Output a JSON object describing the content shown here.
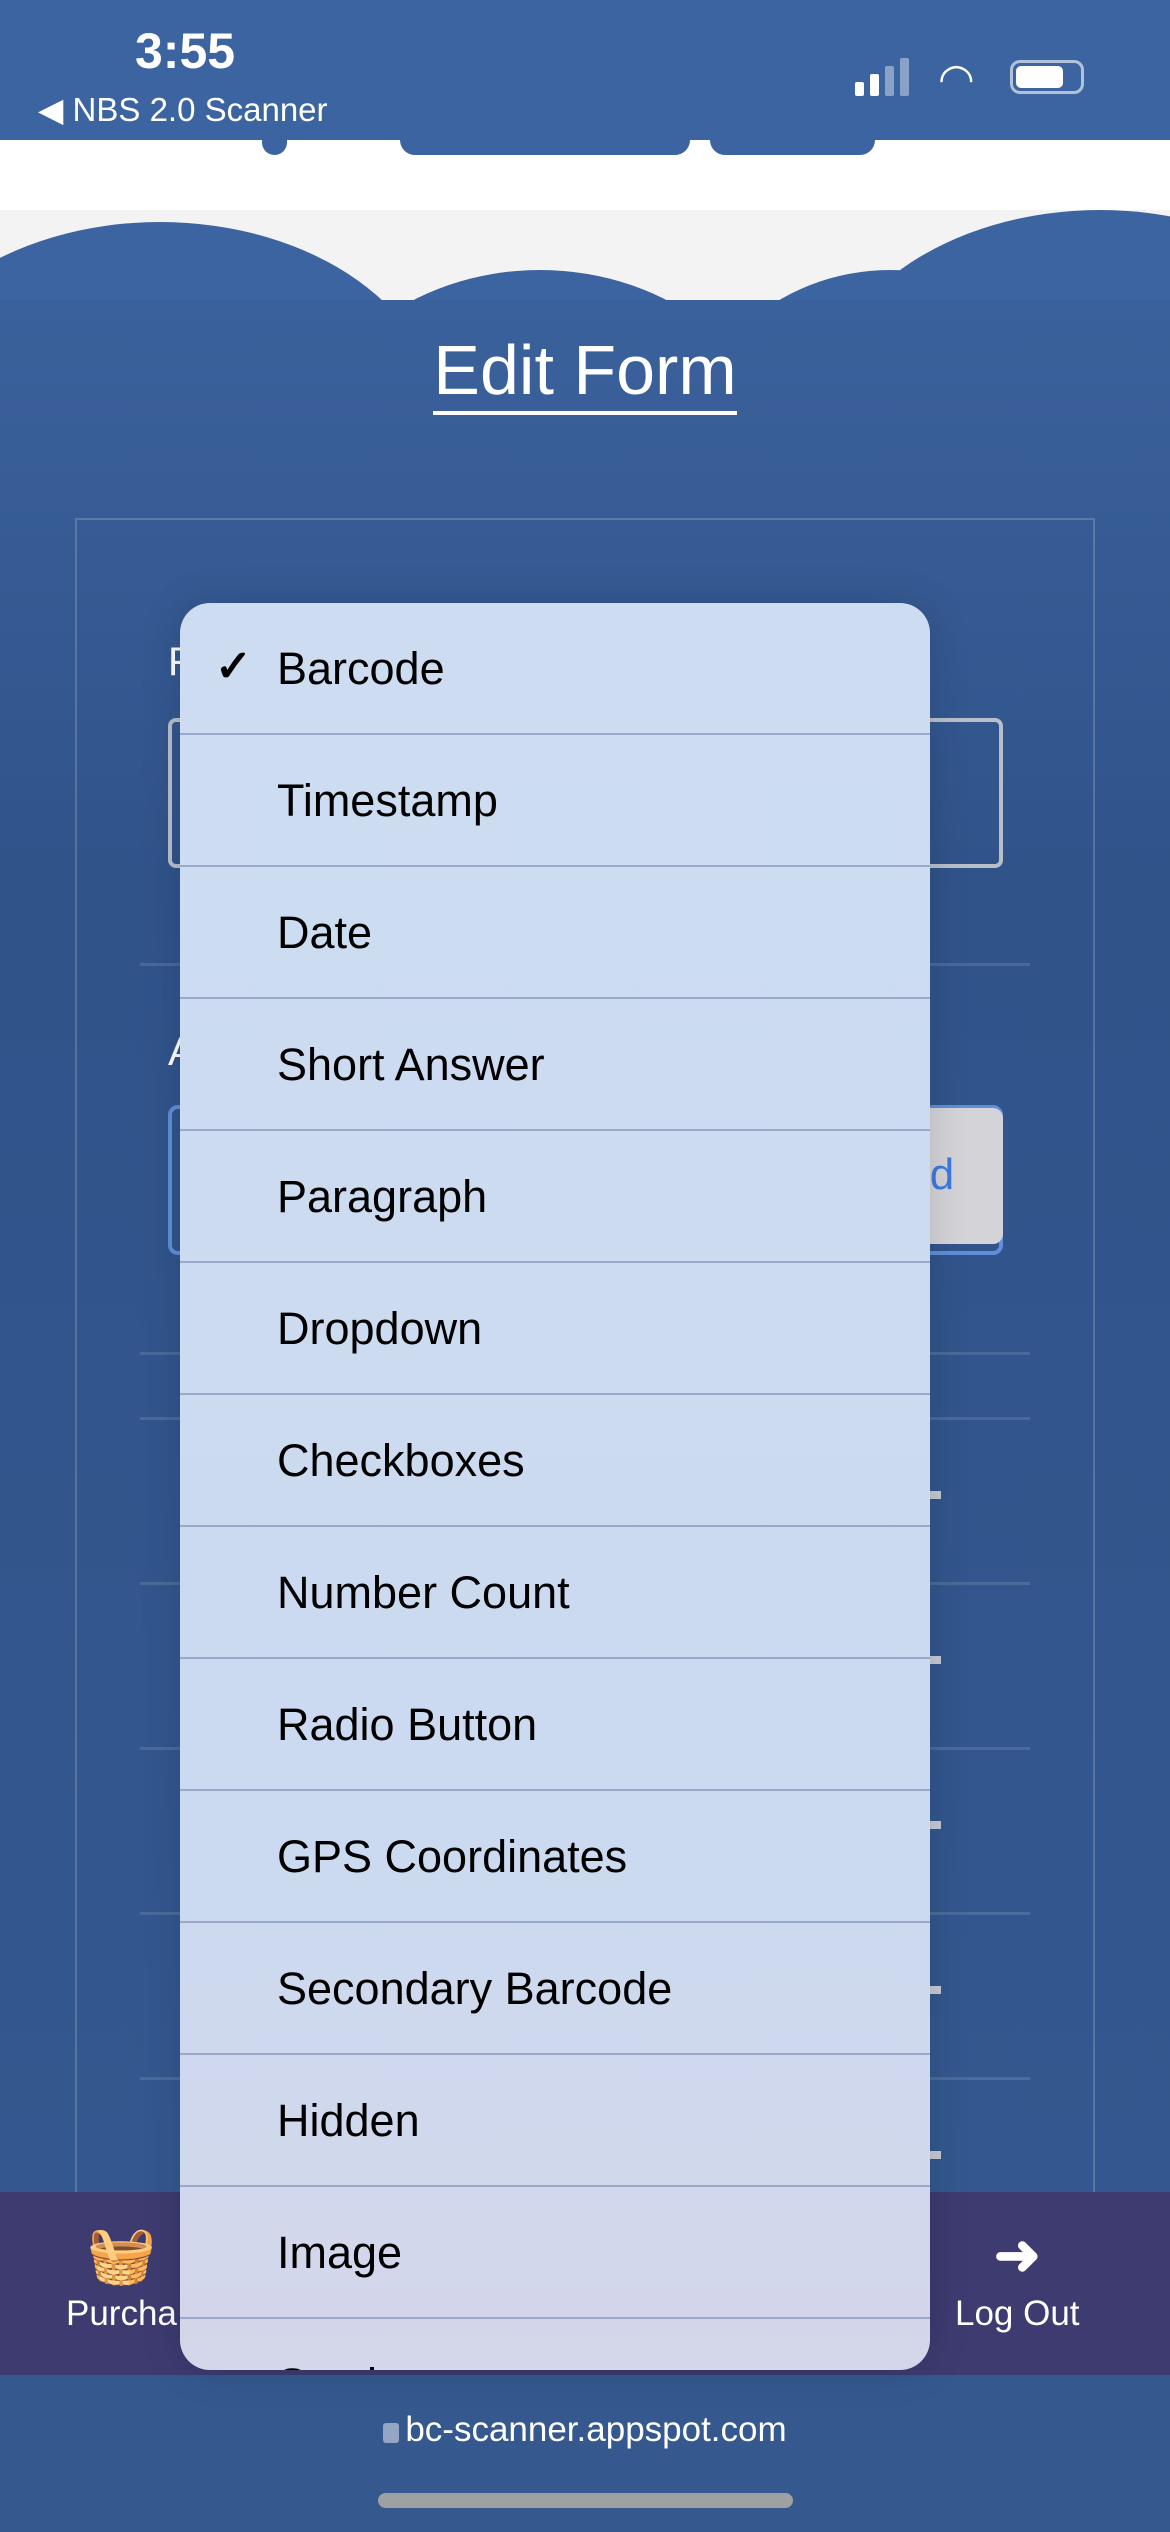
{
  "status_bar": {
    "time": "3:55",
    "back_app": "NBS 2.0 Scanner"
  },
  "page": {
    "title": "Edit Form",
    "add_button_partial": "ld",
    "label_1_partial": "F",
    "label_2_partial": "A"
  },
  "dropdown": {
    "selected": "Barcode",
    "options": [
      "Barcode",
      "Timestamp",
      "Date",
      "Short Answer",
      "Paragraph",
      "Dropdown",
      "Checkboxes",
      "Number Count",
      "Radio Button",
      "GPS Coordinates",
      "Secondary Barcode",
      "Hidden",
      "Image",
      "Stock"
    ]
  },
  "bottom_nav": {
    "purchase": "Purcha",
    "logout": "Log Out"
  },
  "browser": {
    "url": "bc-scanner.appspot.com"
  },
  "colors": {
    "primary": "#3c64a0",
    "nav": "#3d3b70",
    "menu": "#cddcf1",
    "link": "#3d7ae0"
  }
}
